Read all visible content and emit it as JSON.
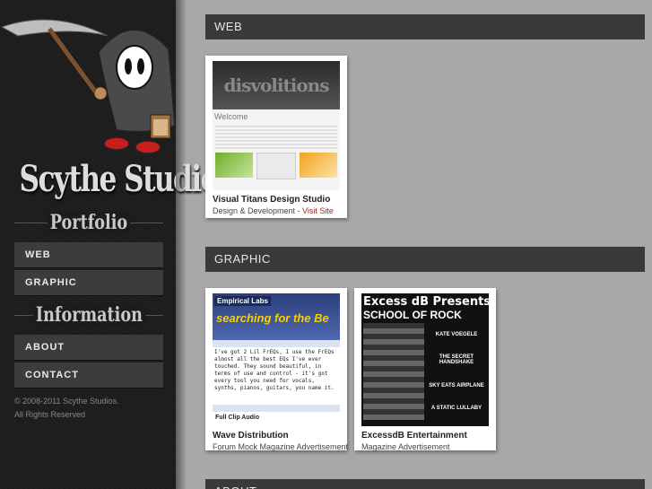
{
  "sidebar": {
    "brand": "Scythe Studios",
    "portfolio_heading": "Portfolio",
    "portfolio_items": [
      {
        "label": "WEB"
      },
      {
        "label": "GRAPHIC"
      }
    ],
    "information_heading": "Information",
    "information_items": [
      {
        "label": "ABOUT"
      },
      {
        "label": "CONTACT"
      }
    ],
    "copyright_line1": "© 2008-2011 Scythe Studios.",
    "copyright_line2": "All Rights Reserved"
  },
  "main": {
    "categories": [
      {
        "title": "WEB",
        "projects": [
          {
            "title": "Visual Titans Design Studio",
            "description": "Design & Development - ",
            "link": "Visit Site"
          }
        ]
      },
      {
        "title": "GRAPHIC",
        "projects": [
          {
            "title": "Wave Distribution",
            "description": "Forum Mock Magazine Advertisement"
          },
          {
            "title": "ExcessdB Entertainment",
            "description": "Magazine Advertisement"
          }
        ]
      },
      {
        "title": "ABOUT"
      }
    ],
    "thumbnails": {
      "visual_titans": {
        "logo": "disvolitions",
        "welcome": "Welcome"
      },
      "wave": {
        "brand": "Empirical Labs",
        "headline": "searching for the Be",
        "text": "I've got 2 Lil FrEQs, I use the FrEQs almost all the best EQs I've ever touched. They sound beautiful, in terms of use and control - it's got every tool you need for vocals, synths, pianos, guitars, you name it.",
        "footer": "Full Clip Audio"
      },
      "excess": {
        "line1": "Excess dB Presents",
        "line2": "SCHOOL OF ROCK",
        "bands": [
          "KATE VOEGELE",
          "THE SECRET HANDSHAKE",
          "SKY EATS AIRPLANE",
          "A STATIC LULLABY"
        ]
      }
    }
  },
  "colors": {
    "accent_link": "#b01d0a",
    "sidebar_bg": "#1c1c1c",
    "button_bg": "#3c3c3c",
    "page_bg": "#a8a8a8"
  }
}
